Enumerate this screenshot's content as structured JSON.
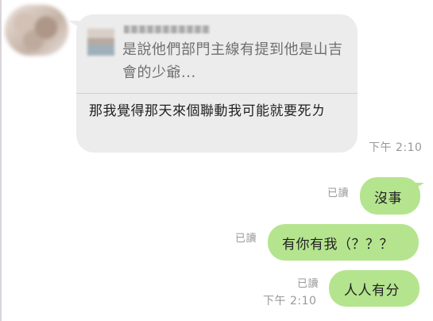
{
  "incoming": {
    "reply_preview_text": "是說他們部門主線有提到他是山吉會的少爺...",
    "message_text": "那我覺得那天來個聯動我可能就要死ㄌ",
    "time": "下午 2:10"
  },
  "outgoing": [
    {
      "read_label": "已讀",
      "text": "沒事",
      "time": ""
    },
    {
      "read_label": "已讀",
      "text": "有你有我（？？？",
      "time": ""
    },
    {
      "read_label": "已讀",
      "text": "人人有分",
      "time": "下午 2:10"
    }
  ],
  "colors": {
    "incoming_bubble": "#ececec",
    "outgoing_bubble": "#b5e48e",
    "meta_text": "#999999"
  }
}
